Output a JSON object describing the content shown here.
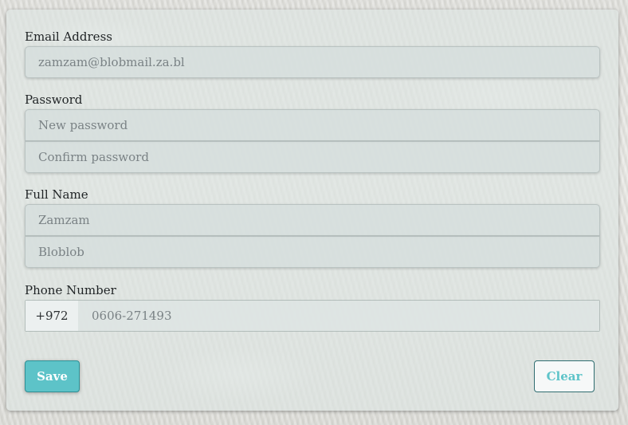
{
  "form": {
    "email": {
      "label": "Email Address",
      "placeholder": "zamzam@blobmail.za.bl"
    },
    "password": {
      "label": "Password",
      "new_placeholder": "New password",
      "confirm_placeholder": "Confirm password"
    },
    "full_name": {
      "label": "Full Name",
      "first_placeholder": "Zamzam",
      "last_placeholder": "Bloblob"
    },
    "phone": {
      "label": "Phone Number",
      "prefix": "+972",
      "placeholder": "0606-271493"
    },
    "buttons": {
      "save_label": "Save",
      "clear_label": "Clear"
    }
  },
  "colors": {
    "accent": "#5dc3c8",
    "accent_border": "#2f8f94",
    "clear_border": "#2f6d70"
  }
}
